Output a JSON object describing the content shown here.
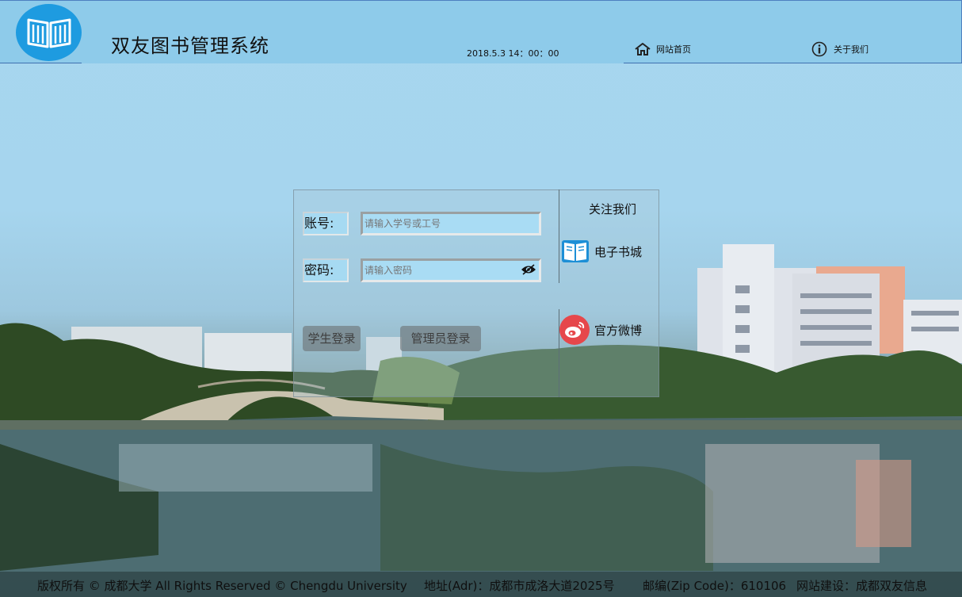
{
  "header": {
    "app_title": "双友图书管理系统",
    "datetime": "2018.5.3  14：00：00",
    "nav": {
      "home_label": "网站首页",
      "about_label": "关于我们"
    }
  },
  "login": {
    "account_label": "账号:",
    "account_placeholder": "请输入学号或工号",
    "account_value": "",
    "password_label": "密码:",
    "password_placeholder": "请输入密码",
    "password_value": "",
    "student_login_label": "学生登录",
    "admin_login_label": "管理员登录"
  },
  "social": {
    "title": "关注我们",
    "ebook_label": "电子书城",
    "weibo_label": "官方微博"
  },
  "footer": {
    "copyright": "版权所有 © 成都大学 All Rights Reserved © Chengdu University",
    "address": "地址(Adr)：成都市成洛大道2025号",
    "zip": "邮编(Zip Code)：610106",
    "builder": "网站建设：成都双友信息"
  },
  "icons": {
    "logo": "open-book-icon",
    "home": "house-icon",
    "about": "info-icon",
    "password_toggle": "eye-icon",
    "ebook": "book-icon",
    "weibo": "weibo-icon"
  },
  "colors": {
    "header_bg": "#8ecbea",
    "logo_bg": "#1e9be0",
    "input_bg": "#a9dcf4",
    "weibo_red": "#e6474b"
  }
}
